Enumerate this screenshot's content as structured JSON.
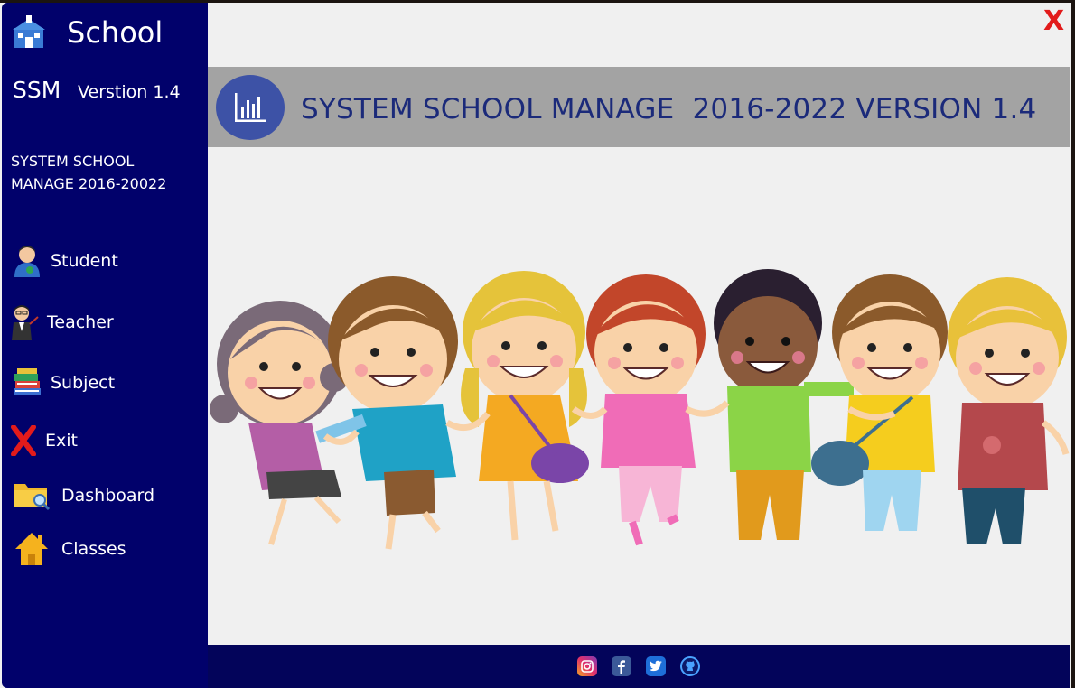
{
  "window": {
    "close_label": "X"
  },
  "sidebar": {
    "app_name": "School",
    "short_name": "SSM",
    "version": "Verstion 1.4",
    "description_line1": "SYSTEM SCHOOL",
    "description_line2": "MANAGE  2016-20022",
    "items": [
      {
        "label": "Student",
        "icon": "student-icon"
      },
      {
        "label": "Teacher",
        "icon": "teacher-icon"
      },
      {
        "label": "Subject",
        "icon": "books-icon"
      },
      {
        "label": "Exit",
        "icon": "exit-x-icon"
      },
      {
        "label": "Dashboard",
        "icon": "folder-search-icon"
      },
      {
        "label": "Classes",
        "icon": "home-icon"
      }
    ]
  },
  "banner": {
    "title": "SYSTEM SCHOOL MANAGE  2016-2022 VERSION 1.4",
    "icon": "bar-chart-icon"
  },
  "footer": {
    "social": [
      "instagram-icon",
      "facebook-icon",
      "twitter-icon",
      "github-icon"
    ]
  },
  "colors": {
    "sidebar_bg": "#01016b",
    "banner_bg": "#a3a3a3",
    "banner_text": "#1b2a7a",
    "footer_bg": "#03045a",
    "close": "#e21b1b"
  }
}
